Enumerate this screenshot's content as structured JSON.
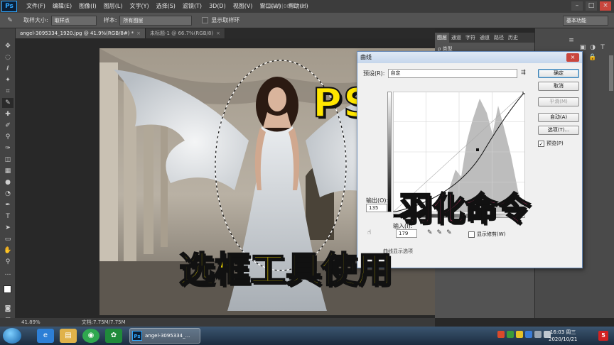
{
  "app": {
    "logo": "Ps",
    "menu": [
      "文件(F)",
      "编辑(E)",
      "图像(I)",
      "图层(L)",
      "文字(Y)",
      "选择(S)",
      "滤镜(T)",
      "3D(D)",
      "视图(V)",
      "窗口(W)",
      "帮助(H)"
    ],
    "recording_overlay": "正在录制 [00:01:10]"
  },
  "options": {
    "sample_size_label": "取样大小:",
    "sample_size_value": "取样点",
    "sample_label": "样本:",
    "sample_value": "所有图层",
    "show_ring_label": "显示取样环",
    "workspace": "基本功能"
  },
  "tabs": [
    {
      "label": "angel-3095334_1920.jpg @ 41.9%(RGB/8#) *",
      "close": "×"
    },
    {
      "label": "未标题-1 @ 66.7%(RGB/8)",
      "close": "×"
    }
  ],
  "status": {
    "zoom": "41.89%",
    "doc": "文档:7.75M/7.75M"
  },
  "panels": {
    "tabs": [
      "图层",
      "通道",
      "字符",
      "通道",
      "路径",
      "历史"
    ],
    "kind": "ρ 类型"
  },
  "curves": {
    "title": "曲线",
    "close": "×",
    "preset_label": "预设(R):",
    "preset_value": "自定",
    "ok": "确定",
    "cancel": "取消",
    "smooth": "平滑(M)",
    "auto": "自动(A)",
    "options": "选项(T)...",
    "preview_label": "预览(P)",
    "preview_checked": "✓",
    "output_label": "输出(O):",
    "output_value": "135",
    "input_label": "输入(I):",
    "input_value": "179",
    "show_clipping": "显示修剪(W)",
    "expand_label": "曲线显示选项"
  },
  "captions": {
    "ps_tutorial": "PS教学",
    "feather": "羽化命令",
    "marquee": "选框工具使用"
  },
  "taskbar": {
    "ps_window": "angel-3095334_...",
    "time": "16:03 周三",
    "date": "2020/10/21",
    "notif": "5"
  },
  "colors": {
    "caption_yellow": "#ffe600",
    "caption_pink": "#e23b76"
  }
}
